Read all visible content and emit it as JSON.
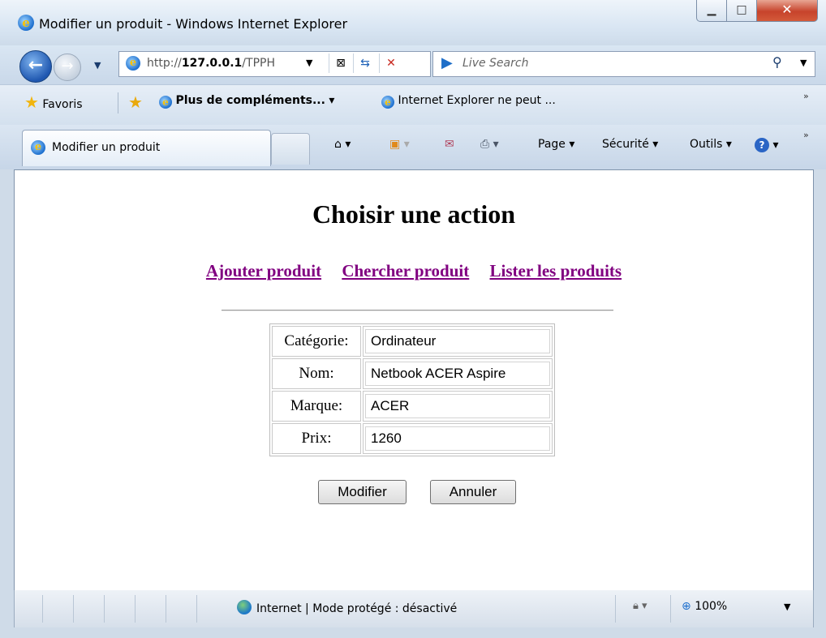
{
  "window": {
    "title": "Modifier un produit - Windows Internet Explorer"
  },
  "navigation": {
    "url_prefix": "http://",
    "url_host": "127.0.0.1",
    "url_rest": "/TPPH",
    "search_placeholder": "Live Search"
  },
  "favorites_bar": {
    "favorites_label": "Favoris",
    "item1": "Plus de compléments...",
    "item2": "Internet Explorer ne peut ..."
  },
  "tab": {
    "label": "Modifier un produit"
  },
  "command_bar": {
    "page": "Page",
    "security": "Sécurité",
    "tools": "Outils"
  },
  "page": {
    "heading": "Choisir une action",
    "links": [
      "Ajouter produit",
      "Chercher produit",
      "Lister les produits"
    ],
    "form": {
      "rows": [
        {
          "label": "Catégorie:",
          "value": "Ordinateur"
        },
        {
          "label": "Nom:",
          "value": "Netbook ACER Aspire"
        },
        {
          "label": "Marque:",
          "value": "ACER"
        },
        {
          "label": "Prix:",
          "value": "1260"
        }
      ],
      "submit_label": "Modifier",
      "cancel_label": "Annuler"
    }
  },
  "status_bar": {
    "zone_text": "Internet | Mode protégé : désactivé",
    "zoom": "100%"
  },
  "colors": {
    "visited_link": "#800080",
    "chrome_blue": "#cfdbe8",
    "close_red": "#c7432b"
  }
}
